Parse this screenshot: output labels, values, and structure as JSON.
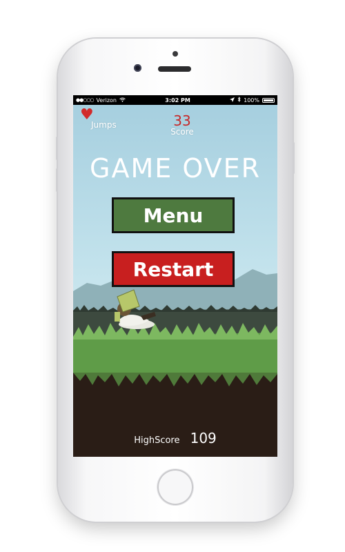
{
  "status_bar": {
    "carrier": "Verizon",
    "time": "3:02 PM",
    "battery": "100%",
    "signal_icon": "signal-dots-icon",
    "wifi_icon": "wifi-icon",
    "location_icon": "location-arrow-icon",
    "bluetooth_icon": "bluetooth-icon"
  },
  "hud": {
    "jumps_icon": "heart-icon",
    "jumps_label": "Jumps",
    "score_value": "33",
    "score_label": "Score"
  },
  "game_over_title": "GAME OVER",
  "buttons": {
    "menu_label": "Menu",
    "restart_label": "Restart"
  },
  "highscore": {
    "label": "HighScore",
    "value": "109"
  },
  "colors": {
    "sky": "#a6cfdf",
    "menu_button": "#4e7a3f",
    "restart_button": "#c81f1f",
    "score_value": "#c62828",
    "heart": "#d22a2a",
    "grass": "#5f9c48",
    "dirt": "#2a1d16"
  }
}
